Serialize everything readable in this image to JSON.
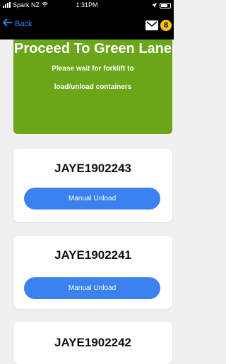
{
  "status_bar": {
    "carrier": "Spark NZ",
    "time": "1:31PM"
  },
  "nav": {
    "back_label": "Back",
    "notification_count": "8"
  },
  "banner": {
    "title": "Proceed To Green Lane",
    "line1": "Please wait for forklift to",
    "line2": "load/unload containers",
    "color": "#6aa617"
  },
  "containers": [
    {
      "code": "JAYE1902243",
      "button_label": "Manual Unload"
    },
    {
      "code": "JAYE1902241",
      "button_label": "Manual Unload"
    },
    {
      "code": "JAYE1902242"
    }
  ],
  "colors": {
    "accent": "#3b82f0",
    "badge": "#f5c518"
  },
  "icons": [
    "wifi-icon",
    "location-arrow-icon",
    "battery-icon",
    "back-arrow-icon",
    "mail-icon"
  ]
}
